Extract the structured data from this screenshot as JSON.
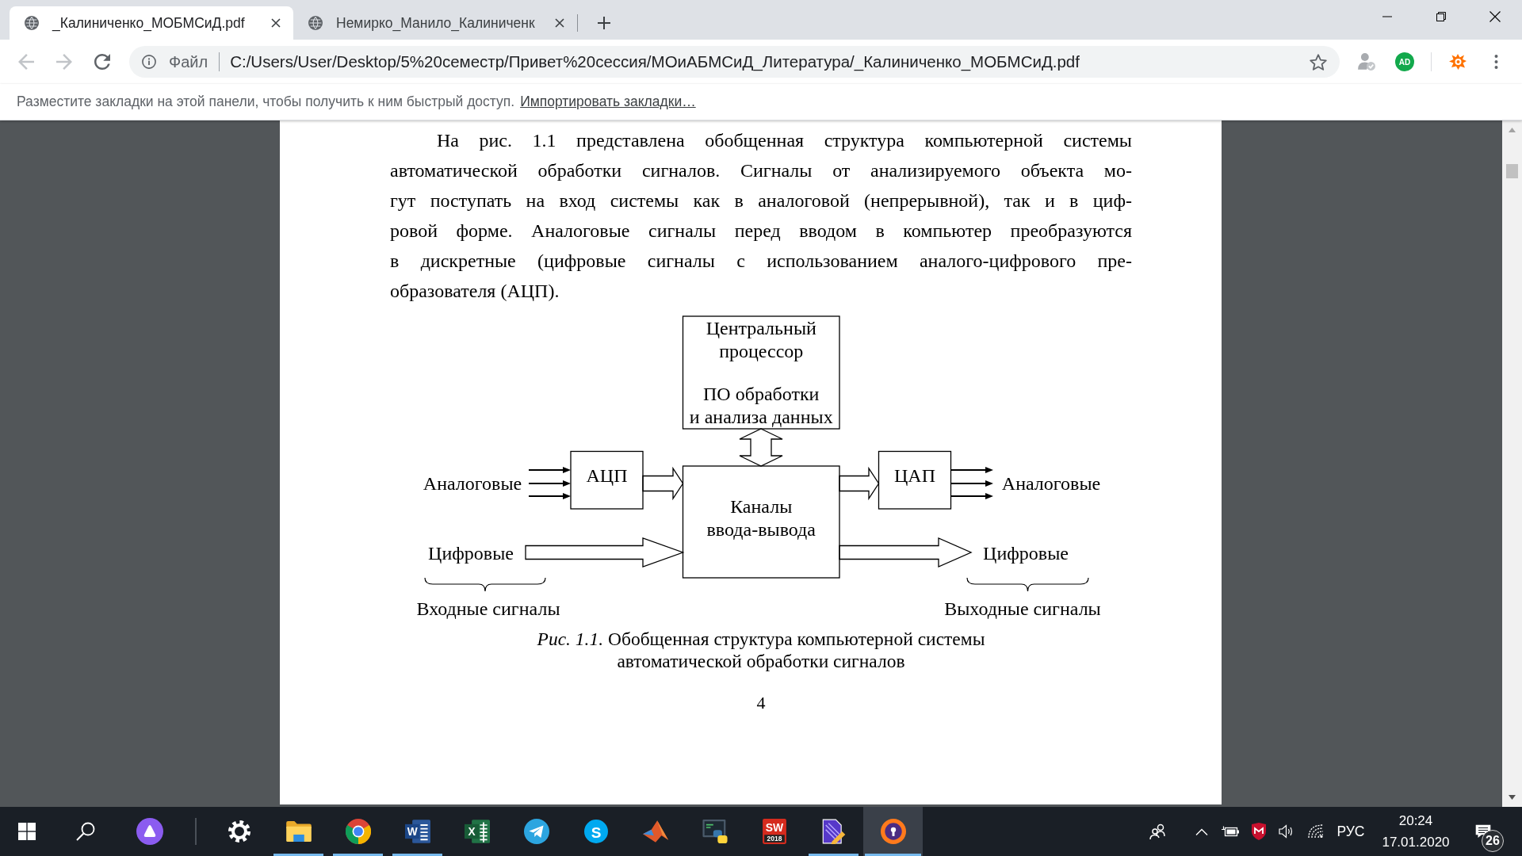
{
  "browser": {
    "tabs": [
      {
        "title": "_Калиниченко_МОБМСиД.pdf",
        "selected": true
      },
      {
        "title": "Немирко_Манило_Калиниченк",
        "selected": false
      }
    ],
    "nav_buttons": [
      {
        "kind": "back",
        "disabled": true
      },
      {
        "kind": "forward",
        "disabled": true
      },
      {
        "kind": "reload",
        "disabled": false
      }
    ],
    "address_bar": {
      "scheme": "Файл",
      "url": "C:/Users/User/Desktop/5%20семестр/Привет%20сессия/МОиАБМСиД_Литература/_Калиниченко_МОБМСиД.pdf"
    },
    "extensions": [
      {
        "kind": "profile-check"
      },
      {
        "kind": "round-badge",
        "glyph": "AD"
      },
      {
        "kind": "splat"
      }
    ],
    "bookmarks_bar": {
      "hint": "Разместите закладки на этой панели, чтобы получить к ним быстрый доступ.",
      "link": "Импортировать закладки…"
    }
  },
  "document": {
    "paragraph_lines": [
      "На рис. 1.1 представлена обобщенная структура компьютерной системы",
      "автоматической обработки сигналов. Сигналы от анализируемого объекта мо-",
      "гут поступать на вход системы как в аналоговой (непрерывной), так и в циф-",
      "ровой форме. Аналоговые сигналы перед вводом в компьютер преобразуются",
      "в дискретные (цифровые сигналы с использованием аналого-цифрового пре-",
      "образователя (АЦП)."
    ],
    "figure": {
      "blocks": [
        {
          "kind": "processor",
          "text_groups": [
            [
              "Центральный",
              "процессор"
            ],
            [
              "ПО обработки",
              "и анализа данных"
            ]
          ]
        },
        {
          "kind": "adc",
          "text_groups": [
            [
              "АЦП"
            ]
          ]
        },
        {
          "kind": "io",
          "text_groups": [
            [
              "Каналы",
              "ввода-вывода"
            ]
          ]
        },
        {
          "kind": "dac",
          "text_groups": [
            [
              "ЦАП"
            ]
          ]
        }
      ],
      "inputs": {
        "analog": "Аналоговые",
        "digital": "Цифровые",
        "group": "Входные сигналы"
      },
      "outputs": {
        "analog": "Аналоговые",
        "digital": "Цифровые",
        "group": "Выходные сигналы"
      },
      "caption_lines": [
        "*Рис. 1.1.* Обобщенная структура компьютерной системы",
        "автоматической обработки сигналов"
      ]
    },
    "page_number": "4"
  },
  "taskbar": {
    "apps": [
      {
        "kind": "gear",
        "running": false,
        "selected": false
      },
      {
        "kind": "folder",
        "running": true,
        "selected": false
      },
      {
        "kind": "ring-logo",
        "running": true,
        "selected": false
      },
      {
        "kind": "letter-tile",
        "glyph": "W",
        "running": true,
        "selected": false
      },
      {
        "kind": "sheet-tile",
        "glyph": "X",
        "running": false,
        "selected": false
      },
      {
        "kind": "paper-plane",
        "running": false,
        "selected": false
      },
      {
        "kind": "letter-disc",
        "glyph": "S",
        "running": false,
        "selected": false
      },
      {
        "kind": "peak",
        "running": false,
        "selected": false
      },
      {
        "kind": "monitor-logo",
        "running": false,
        "selected": false
      },
      {
        "kind": "version-tile",
        "glyph": "SW",
        "version": "2018",
        "running": false,
        "selected": false
      },
      {
        "kind": "pen-doc",
        "running": true,
        "selected": false
      },
      {
        "kind": "lock-ring",
        "running": true,
        "selected": true
      }
    ],
    "tray": {
      "language": "РУС",
      "time": "20:24",
      "date": "17.01.2020",
      "notifications": "26"
    }
  }
}
